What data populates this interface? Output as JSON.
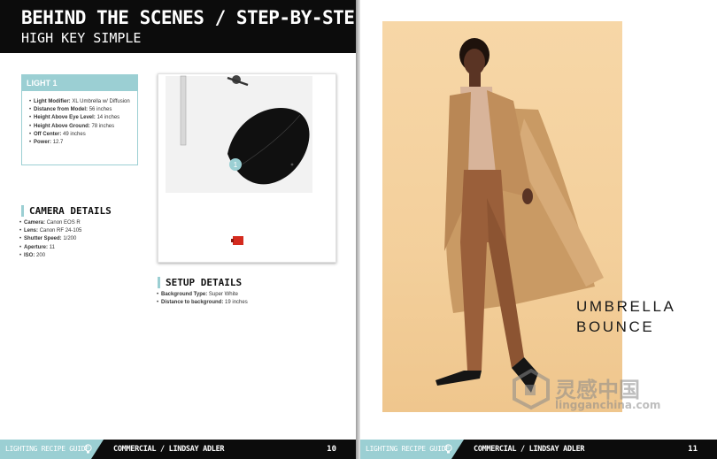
{
  "left_page": {
    "header": {
      "title": "BEHIND THE SCENES / STEP-BY-STEP",
      "subtitle": "HIGH KEY SIMPLE"
    },
    "light_card": {
      "heading": "LIGHT 1",
      "items": [
        {
          "label": "Light Modifier:",
          "value": "XL Umbrella  w/ Diffusion"
        },
        {
          "label": "Distance from Model:",
          "value": "56 inches"
        },
        {
          "label": "Height Above Eye Level:",
          "value": "14 inches"
        },
        {
          "label": "Height Above Ground:",
          "value": "78 inches"
        },
        {
          "label": "Off Center:",
          "value": "49 inches"
        },
        {
          "label": "Power:",
          "value": "12.7"
        }
      ]
    },
    "camera_details": {
      "heading": "CAMERA DETAILS",
      "items": [
        {
          "label": "Camera:",
          "value": "Canon EOS R"
        },
        {
          "label": "Lens:",
          "value": "Canon RF 24-105"
        },
        {
          "label": "Shutter Speed:",
          "value": "1/200"
        },
        {
          "label": "Aperture:",
          "value": "11"
        },
        {
          "label": "ISO:",
          "value": "200"
        }
      ]
    },
    "diagram": {
      "light_marker": "1"
    },
    "setup_details": {
      "heading": "SETUP DETAILS",
      "items": [
        {
          "label": "Background Type:",
          "value": "Super White"
        },
        {
          "label": "Distance to background:",
          "value": "19 inches"
        }
      ]
    },
    "footer": {
      "guide_label": "LIGHTING RECIPE GUIDE",
      "credit": "COMMERCIAL / LINDSAY ADLER",
      "page_number": "10"
    }
  },
  "right_page": {
    "photo_title_line1": "UMBRELLA",
    "photo_title_line2": "BOUNCE",
    "watermark": {
      "chinese": "灵感中国",
      "url": "lingganchina.com"
    },
    "footer": {
      "guide_label": "LIGHTING RECIPE GUIDE",
      "credit": "COMMERCIAL / LINDSAY ADLER",
      "page_number": "11"
    }
  },
  "colors": {
    "accent": "#9bcfd3",
    "banner": "#0c0c0c",
    "photo_background": "#f3cf9b",
    "coat": "#c99a64",
    "suit": "#9a5f3a"
  },
  "icons": [
    "lightbulb-icon",
    "camera-icon",
    "umbrella-light-icon",
    "light-stand-icon",
    "watermark-logo-icon"
  ]
}
